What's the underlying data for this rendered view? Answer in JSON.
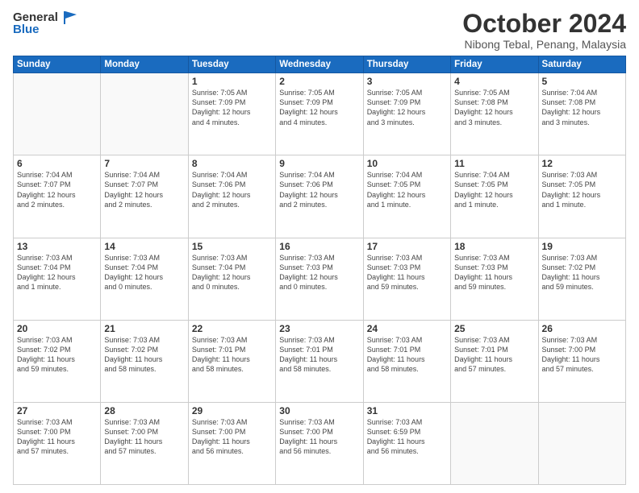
{
  "logo": {
    "line1": "General",
    "line2": "Blue"
  },
  "title": "October 2024",
  "subtitle": "Nibong Tebal, Penang, Malaysia",
  "headers": [
    "Sunday",
    "Monday",
    "Tuesday",
    "Wednesday",
    "Thursday",
    "Friday",
    "Saturday"
  ],
  "weeks": [
    {
      "cells": [
        {
          "day": "",
          "info": ""
        },
        {
          "day": "",
          "info": ""
        },
        {
          "day": "1",
          "info": "Sunrise: 7:05 AM\nSunset: 7:09 PM\nDaylight: 12 hours\nand 4 minutes."
        },
        {
          "day": "2",
          "info": "Sunrise: 7:05 AM\nSunset: 7:09 PM\nDaylight: 12 hours\nand 4 minutes."
        },
        {
          "day": "3",
          "info": "Sunrise: 7:05 AM\nSunset: 7:09 PM\nDaylight: 12 hours\nand 3 minutes."
        },
        {
          "day": "4",
          "info": "Sunrise: 7:05 AM\nSunset: 7:08 PM\nDaylight: 12 hours\nand 3 minutes."
        },
        {
          "day": "5",
          "info": "Sunrise: 7:04 AM\nSunset: 7:08 PM\nDaylight: 12 hours\nand 3 minutes."
        }
      ]
    },
    {
      "cells": [
        {
          "day": "6",
          "info": "Sunrise: 7:04 AM\nSunset: 7:07 PM\nDaylight: 12 hours\nand 2 minutes."
        },
        {
          "day": "7",
          "info": "Sunrise: 7:04 AM\nSunset: 7:07 PM\nDaylight: 12 hours\nand 2 minutes."
        },
        {
          "day": "8",
          "info": "Sunrise: 7:04 AM\nSunset: 7:06 PM\nDaylight: 12 hours\nand 2 minutes."
        },
        {
          "day": "9",
          "info": "Sunrise: 7:04 AM\nSunset: 7:06 PM\nDaylight: 12 hours\nand 2 minutes."
        },
        {
          "day": "10",
          "info": "Sunrise: 7:04 AM\nSunset: 7:05 PM\nDaylight: 12 hours\nand 1 minute."
        },
        {
          "day": "11",
          "info": "Sunrise: 7:04 AM\nSunset: 7:05 PM\nDaylight: 12 hours\nand 1 minute."
        },
        {
          "day": "12",
          "info": "Sunrise: 7:03 AM\nSunset: 7:05 PM\nDaylight: 12 hours\nand 1 minute."
        }
      ]
    },
    {
      "cells": [
        {
          "day": "13",
          "info": "Sunrise: 7:03 AM\nSunset: 7:04 PM\nDaylight: 12 hours\nand 1 minute."
        },
        {
          "day": "14",
          "info": "Sunrise: 7:03 AM\nSunset: 7:04 PM\nDaylight: 12 hours\nand 0 minutes."
        },
        {
          "day": "15",
          "info": "Sunrise: 7:03 AM\nSunset: 7:04 PM\nDaylight: 12 hours\nand 0 minutes."
        },
        {
          "day": "16",
          "info": "Sunrise: 7:03 AM\nSunset: 7:03 PM\nDaylight: 12 hours\nand 0 minutes."
        },
        {
          "day": "17",
          "info": "Sunrise: 7:03 AM\nSunset: 7:03 PM\nDaylight: 11 hours\nand 59 minutes."
        },
        {
          "day": "18",
          "info": "Sunrise: 7:03 AM\nSunset: 7:03 PM\nDaylight: 11 hours\nand 59 minutes."
        },
        {
          "day": "19",
          "info": "Sunrise: 7:03 AM\nSunset: 7:02 PM\nDaylight: 11 hours\nand 59 minutes."
        }
      ]
    },
    {
      "cells": [
        {
          "day": "20",
          "info": "Sunrise: 7:03 AM\nSunset: 7:02 PM\nDaylight: 11 hours\nand 59 minutes."
        },
        {
          "day": "21",
          "info": "Sunrise: 7:03 AM\nSunset: 7:02 PM\nDaylight: 11 hours\nand 58 minutes."
        },
        {
          "day": "22",
          "info": "Sunrise: 7:03 AM\nSunset: 7:01 PM\nDaylight: 11 hours\nand 58 minutes."
        },
        {
          "day": "23",
          "info": "Sunrise: 7:03 AM\nSunset: 7:01 PM\nDaylight: 11 hours\nand 58 minutes."
        },
        {
          "day": "24",
          "info": "Sunrise: 7:03 AM\nSunset: 7:01 PM\nDaylight: 11 hours\nand 58 minutes."
        },
        {
          "day": "25",
          "info": "Sunrise: 7:03 AM\nSunset: 7:01 PM\nDaylight: 11 hours\nand 57 minutes."
        },
        {
          "day": "26",
          "info": "Sunrise: 7:03 AM\nSunset: 7:00 PM\nDaylight: 11 hours\nand 57 minutes."
        }
      ]
    },
    {
      "cells": [
        {
          "day": "27",
          "info": "Sunrise: 7:03 AM\nSunset: 7:00 PM\nDaylight: 11 hours\nand 57 minutes."
        },
        {
          "day": "28",
          "info": "Sunrise: 7:03 AM\nSunset: 7:00 PM\nDaylight: 11 hours\nand 57 minutes."
        },
        {
          "day": "29",
          "info": "Sunrise: 7:03 AM\nSunset: 7:00 PM\nDaylight: 11 hours\nand 56 minutes."
        },
        {
          "day": "30",
          "info": "Sunrise: 7:03 AM\nSunset: 7:00 PM\nDaylight: 11 hours\nand 56 minutes."
        },
        {
          "day": "31",
          "info": "Sunrise: 7:03 AM\nSunset: 6:59 PM\nDaylight: 11 hours\nand 56 minutes."
        },
        {
          "day": "",
          "info": ""
        },
        {
          "day": "",
          "info": ""
        }
      ]
    }
  ]
}
